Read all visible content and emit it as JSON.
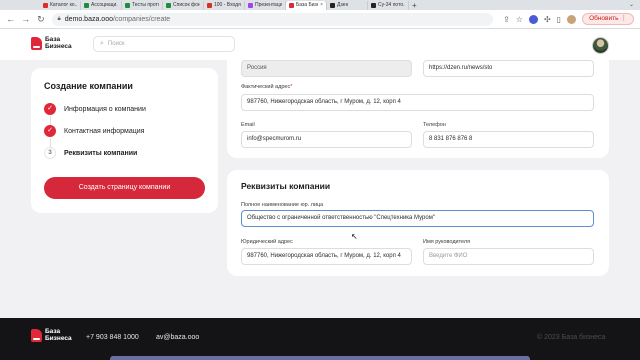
{
  "browser": {
    "tabs": [
      {
        "title": "Каталог ко...",
        "color": "#d93025"
      },
      {
        "title": "Ассоциаци...",
        "color": "#1e8e3e"
      },
      {
        "title": "Тесты прото...",
        "color": "#1e8e3e"
      },
      {
        "title": "Список фон...",
        "color": "#1e8e3e"
      },
      {
        "title": "100 - Входя...",
        "color": "#d93025"
      },
      {
        "title": "Презентаци...",
        "color": "#a142f4"
      },
      {
        "title": "База Бизнес...",
        "color": "#e0283a",
        "active": true
      },
      {
        "title": "Дзен",
        "color": "#222"
      },
      {
        "title": "Су-34 пото...",
        "color": "#222"
      }
    ],
    "url_host": "demo.baza.ooo",
    "url_path": "/companies/create",
    "update_label": "Обновить"
  },
  "header": {
    "logo_line1": "База",
    "logo_line2": "Бизнеса",
    "search_placeholder": "Поиск"
  },
  "sidebar": {
    "title": "Создание компании",
    "steps": [
      {
        "label": "Информация о компании",
        "state": "done",
        "marker": "✓"
      },
      {
        "label": "Контактная информация",
        "state": "done",
        "marker": "✓"
      },
      {
        "label": "Реквизиты компании",
        "state": "current",
        "marker": "3"
      }
    ],
    "create_button": "Создать страницу компании"
  },
  "contacts": {
    "country_value": "Россия",
    "website_value": "https://dzen.ru/news/sto",
    "actual_address_label": "Фактический адрес",
    "actual_address_value": "987760, Нижегородская область, г Муром, д. 12, корп 4",
    "email_label": "Email",
    "email_value": "info@specmurom.ru",
    "phone_label": "Телефон",
    "phone_value": "8 831 876 876 8"
  },
  "requisites": {
    "title": "Реквизиты компании",
    "legal_name_label": "Полное наименование юр. лица",
    "legal_name_value": "Общество с ограниченной ответственностью \"Спецтехника Муром\"",
    "legal_address_label": "Юридический адрес",
    "legal_address_value": "987760, Нижегородская область, г Муром, д. 12, корп 4",
    "director_label": "Имя руководителя",
    "director_placeholder": "Введите ФИО"
  },
  "footer": {
    "logo_line1": "База",
    "logo_line2": "Бизнеса",
    "phone": "+7 903 848 1000",
    "email": "av@baza.ooo",
    "copyright": "© 2023 База бизнеса"
  }
}
